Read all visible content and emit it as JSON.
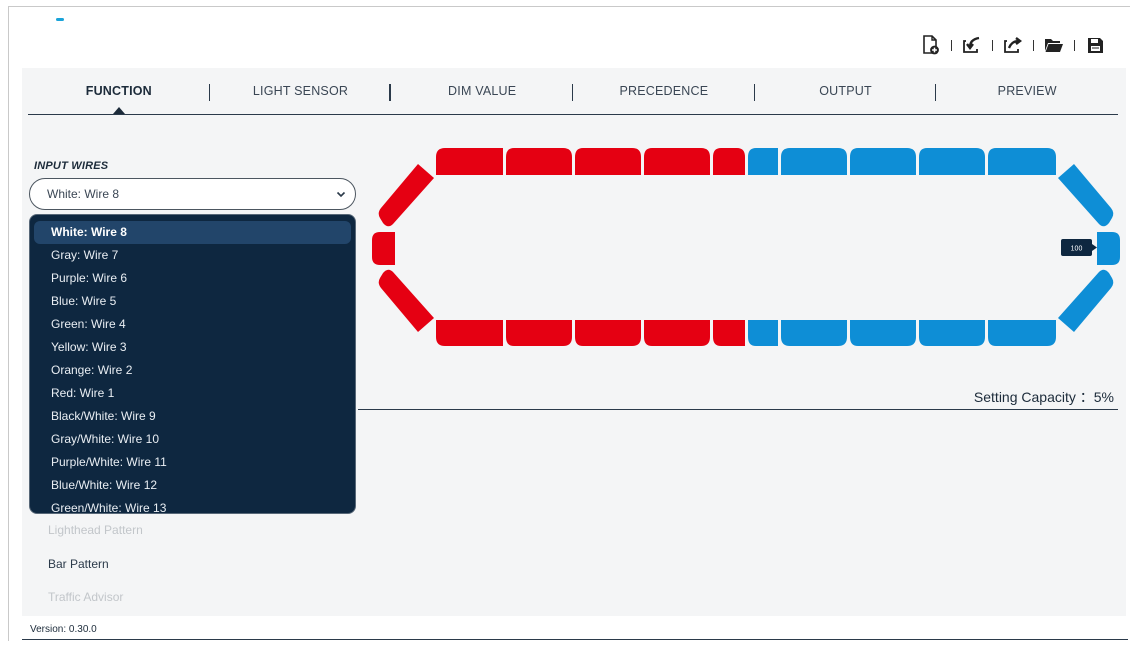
{
  "toolbar": {
    "buttons": [
      {
        "icon": "new-file-icon"
      },
      {
        "icon": "import-icon"
      },
      {
        "icon": "export-icon"
      },
      {
        "icon": "open-folder-icon"
      },
      {
        "icon": "save-icon"
      }
    ]
  },
  "tabs": [
    {
      "label": "FUNCTION",
      "active": true
    },
    {
      "label": "LIGHT SENSOR",
      "active": false
    },
    {
      "label": "DIM VALUE",
      "active": false
    },
    {
      "label": "PRECEDENCE",
      "active": false
    },
    {
      "label": "OUTPUT",
      "active": false
    },
    {
      "label": "PREVIEW",
      "active": false
    }
  ],
  "input_wires": {
    "label": "INPUT WIRES",
    "selected_value": "White:  Wire 8",
    "options": [
      "White:  Wire 8",
      "Gray:  Wire 7",
      "Purple:  Wire 6",
      "Blue:  Wire 5",
      "Green:  Wire 4",
      "Yellow:  Wire 3",
      "Orange:  Wire 2",
      "Red:  Wire 1",
      "Black/White:  Wire 9",
      "Gray/White:  Wire 10",
      "Purple/White:  Wire 11",
      "Blue/White:  Wire 12",
      "Green/White:  Wire 13"
    ]
  },
  "patterns": [
    {
      "label": "Lighthead Pattern",
      "enabled": false
    },
    {
      "label": "Bar Pattern",
      "enabled": true
    },
    {
      "label": "Traffic Advisor",
      "enabled": false
    }
  ],
  "lightbar": {
    "colors": {
      "red": "#e50012",
      "blue": "#0e8ed6"
    },
    "end_badge": "100"
  },
  "setting_capacity": "Setting Capacity ：5%",
  "version": "Version: 0.30.0"
}
